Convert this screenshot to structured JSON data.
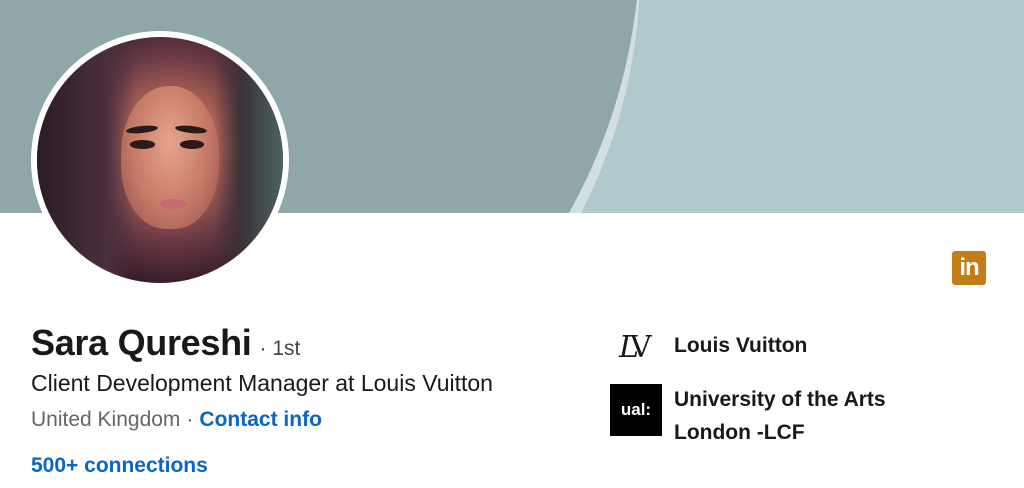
{
  "profile": {
    "name": "Sara Qureshi",
    "degree": "· 1st",
    "headline": "Client Development Manager at Louis Vuitton",
    "location": "United Kingdom",
    "separator": "·",
    "contact_label": "Contact info",
    "connections": "500+ connections"
  },
  "experience": {
    "company": "Louis Vuitton",
    "logo_text": "LV"
  },
  "education": {
    "school": "University of the Arts London -LCF",
    "logo_text": "ual:"
  },
  "badge": {
    "icon": "linkedin-icon",
    "text": "in",
    "color": "#c37d16"
  },
  "colors": {
    "link": "#0a66c2",
    "banner_dark": "#8fa7a8",
    "banner_light": "#b0c9cc"
  }
}
